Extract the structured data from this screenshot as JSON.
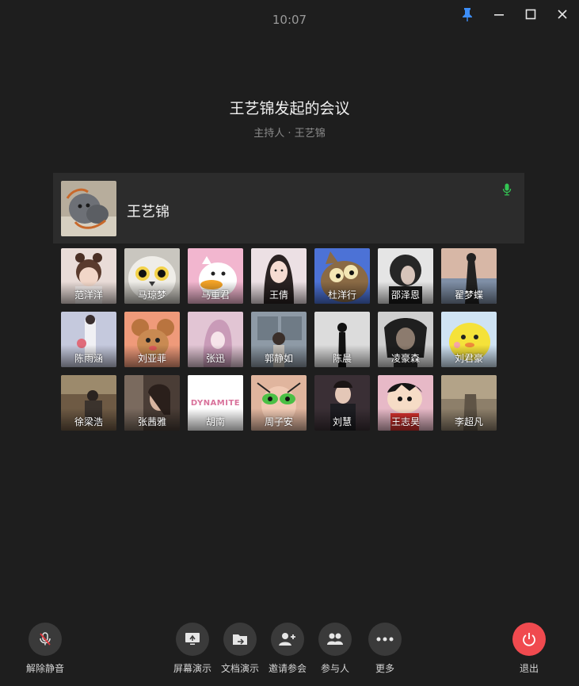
{
  "window": {
    "clock": "10:07"
  },
  "meeting": {
    "title": "王艺锦发起的会议",
    "host_line": "主持人 · 王艺锦"
  },
  "host": {
    "name": "王艺锦",
    "mic": "mic-on-icon",
    "mic_color": "#33c653"
  },
  "participants": [
    {
      "name": "范洋洋"
    },
    {
      "name": "马琼梦"
    },
    {
      "name": "马重君"
    },
    {
      "name": "王倩"
    },
    {
      "name": "杜洋行"
    },
    {
      "name": "邵泽恩"
    },
    {
      "name": "翟梦蝶"
    },
    {
      "name": "陈雨涵"
    },
    {
      "name": "刘亚菲"
    },
    {
      "name": "张迅"
    },
    {
      "name": "郭静如"
    },
    {
      "name": "陈晨"
    },
    {
      "name": "凌豪森"
    },
    {
      "name": "刘君豪"
    },
    {
      "name": "徐梁浩"
    },
    {
      "name": "张茜雅"
    },
    {
      "name": "胡南"
    },
    {
      "name": "周子安"
    },
    {
      "name": "刘慧"
    },
    {
      "name": "王志昊"
    },
    {
      "name": "李超凡"
    }
  ],
  "avatar_text": {
    "dynamite": "DYNAMITE"
  },
  "toolbar": {
    "unmute": "解除静音",
    "screen_share": "屏幕演示",
    "doc_share": "文档演示",
    "invite": "邀请参会",
    "participants": "参与人",
    "more": "更多",
    "leave": "退出"
  },
  "colors": {
    "background": "#1e1e1e",
    "card": "#2c2c2c",
    "button": "#3a3a3a",
    "leave": "#f04a4f",
    "pin": "#3d8ef7",
    "mute_slash": "#e0363c"
  }
}
